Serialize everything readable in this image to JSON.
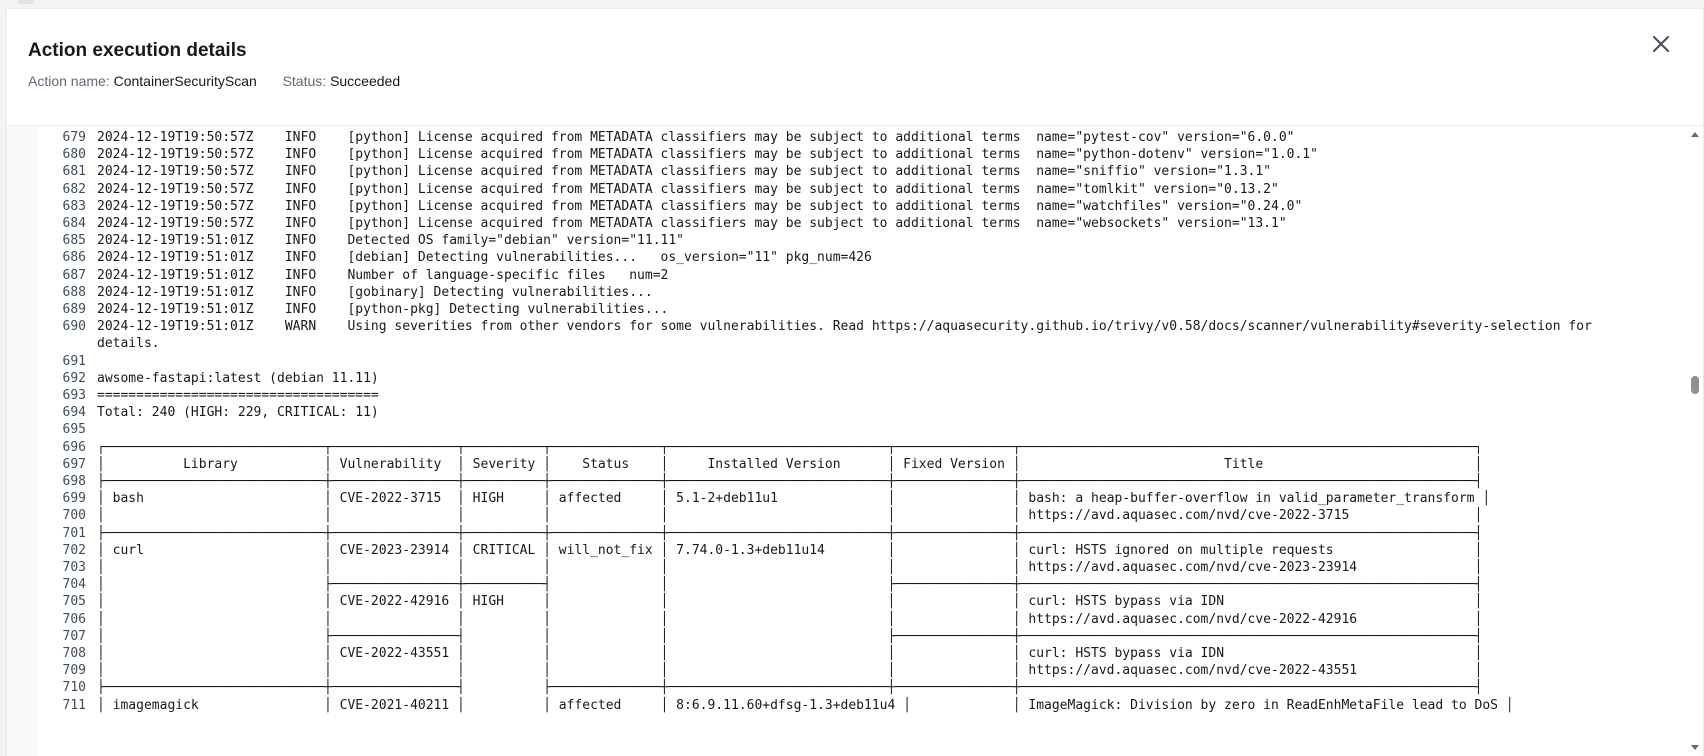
{
  "modal": {
    "title": "Action execution details",
    "action_name_label": "Action name:",
    "action_name": "ContainerSecurityScan",
    "status_label": "Status:",
    "status": "Succeeded"
  },
  "icons": {
    "close": "close-icon",
    "scroll_up": "caret-up-icon",
    "scroll_down": "caret-down-icon"
  },
  "colors": {
    "text": "#16191f",
    "muted": "#5f6b7a",
    "border": "#e9ebed"
  },
  "log": {
    "lines": [
      {
        "n": "679",
        "t": "2024-12-19T19:50:57Z    INFO    [python] License acquired from METADATA classifiers may be subject to additional terms  name=\"pytest-cov\" version=\"6.0.0\""
      },
      {
        "n": "680",
        "t": "2024-12-19T19:50:57Z    INFO    [python] License acquired from METADATA classifiers may be subject to additional terms  name=\"python-dotenv\" version=\"1.0.1\""
      },
      {
        "n": "681",
        "t": "2024-12-19T19:50:57Z    INFO    [python] License acquired from METADATA classifiers may be subject to additional terms  name=\"sniffio\" version=\"1.3.1\""
      },
      {
        "n": "682",
        "t": "2024-12-19T19:50:57Z    INFO    [python] License acquired from METADATA classifiers may be subject to additional terms  name=\"tomlkit\" version=\"0.13.2\""
      },
      {
        "n": "683",
        "t": "2024-12-19T19:50:57Z    INFO    [python] License acquired from METADATA classifiers may be subject to additional terms  name=\"watchfiles\" version=\"0.24.0\""
      },
      {
        "n": "684",
        "t": "2024-12-19T19:50:57Z    INFO    [python] License acquired from METADATA classifiers may be subject to additional terms  name=\"websockets\" version=\"13.1\""
      },
      {
        "n": "685",
        "t": "2024-12-19T19:51:01Z    INFO    Detected OS family=\"debian\" version=\"11.11\""
      },
      {
        "n": "686",
        "t": "2024-12-19T19:51:01Z    INFO    [debian] Detecting vulnerabilities...   os_version=\"11\" pkg_num=426"
      },
      {
        "n": "687",
        "t": "2024-12-19T19:51:01Z    INFO    Number of language-specific files   num=2"
      },
      {
        "n": "688",
        "t": "2024-12-19T19:51:01Z    INFO    [gobinary] Detecting vulnerabilities..."
      },
      {
        "n": "689",
        "t": "2024-12-19T19:51:01Z    INFO    [python-pkg] Detecting vulnerabilities..."
      },
      {
        "n": "690",
        "t": "2024-12-19T19:51:01Z    WARN    Using severities from other vendors for some vulnerabilities. Read https://aquasecurity.github.io/trivy/v0.58/docs/scanner/vulnerability#severity-selection for"
      },
      {
        "n": "",
        "t": "details."
      },
      {
        "n": "691",
        "t": ""
      },
      {
        "n": "692",
        "t": "awsome-fastapi:latest (debian 11.11)"
      },
      {
        "n": "693",
        "t": "===================================="
      },
      {
        "n": "694",
        "t": "Total: 240 (HIGH: 229, CRITICAL: 11)"
      },
      {
        "n": "695",
        "t": ""
      },
      {
        "n": "696",
        "t": "┌────────────────────────────┬────────────────┬──────────┬──────────────┬────────────────────────────┬───────────────┬──────────────────────────────────────────────────────────┐"
      },
      {
        "n": "697",
        "t": "│          Library           │ Vulnerability  │ Severity │    Status    │     Installed Version      │ Fixed Version │                          Title                           │"
      },
      {
        "n": "698",
        "t": "├────────────────────────────┼────────────────┼──────────┼──────────────┼────────────────────────────┼───────────────┼──────────────────────────────────────────────────────────┤"
      },
      {
        "n": "699",
        "t": "│ bash                       │ CVE-2022-3715  │ HIGH     │ affected     │ 5.1-2+deb11u1              │               │ bash: a heap-buffer-overflow in valid_parameter_transform │"
      },
      {
        "n": "700",
        "t": "│                            │                │          │              │                            │               │ https://avd.aquasec.com/nvd/cve-2022-3715                │"
      },
      {
        "n": "701",
        "t": "├────────────────────────────┼────────────────┼──────────┼──────────────┼────────────────────────────┼───────────────┼──────────────────────────────────────────────────────────┤"
      },
      {
        "n": "702",
        "t": "│ curl                       │ CVE-2023-23914 │ CRITICAL │ will_not_fix │ 7.74.0-1.3+deb11u14        │               │ curl: HSTS ignored on multiple requests                  │"
      },
      {
        "n": "703",
        "t": "│                            │                │          │              │                            │               │ https://avd.aquasec.com/nvd/cve-2023-23914               │"
      },
      {
        "n": "704",
        "t": "│                            ├────────────────┼──────────┤              │                            ├───────────────┼──────────────────────────────────────────────────────────┤"
      },
      {
        "n": "705",
        "t": "│                            │ CVE-2022-42916 │ HIGH     │              │                            │               │ curl: HSTS bypass via IDN                                │"
      },
      {
        "n": "706",
        "t": "│                            │                │          │              │                            │               │ https://avd.aquasec.com/nvd/cve-2022-42916               │"
      },
      {
        "n": "707",
        "t": "│                            ├────────────────┤          │              │                            ├───────────────┼──────────────────────────────────────────────────────────┤"
      },
      {
        "n": "708",
        "t": "│                            │ CVE-2022-43551 │          │              │                            │               │ curl: HSTS bypass via IDN                                │"
      },
      {
        "n": "709",
        "t": "│                            │                │          │              │                            │               │ https://avd.aquasec.com/nvd/cve-2022-43551               │"
      },
      {
        "n": "710",
        "t": "├────────────────────────────┼────────────────┤          ├──────────────┼────────────────────────────┼───────────────┼──────────────────────────────────────────────────────────┤"
      },
      {
        "n": "711",
        "t": "│ imagemagick                │ CVE-2021-40211 │          │ affected     │ 8:6.9.11.60+dfsg-1.3+deb11u4 │             │ ImageMagick: Division by zero in ReadEnhMetaFile lead to DoS │"
      }
    ]
  }
}
